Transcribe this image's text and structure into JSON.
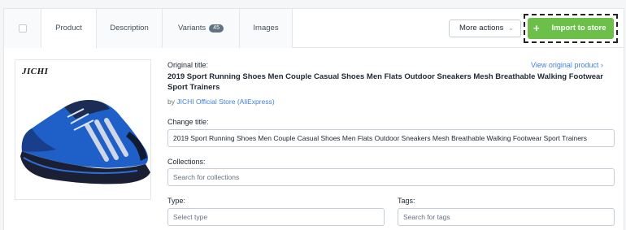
{
  "tabs": {
    "product": "Product",
    "description": "Description",
    "variants": "Variants",
    "variants_count": "45",
    "images": "Images"
  },
  "actions": {
    "more_actions": "More actions",
    "import_to_store": "Import to store"
  },
  "product": {
    "brand_logo_text": "JICHI",
    "original_title_label": "Original title:",
    "original_title": "2019 Sport Running Shoes Men Couple Casual Shoes Men Flats Outdoor Sneakers Mesh Breathable Walking Footwear Sport Trainers",
    "view_original_link": "View original product",
    "by_prefix": "by",
    "store_name": "JICHI Official Store (AliExpress)"
  },
  "form": {
    "change_title_label": "Change title:",
    "change_title_value": "2019 Sport Running Shoes Men Couple Casual Shoes Men Flats Outdoor Sneakers Mesh Breathable Walking Footwear Sport Trainers",
    "collections_label": "Collections:",
    "collections_placeholder": "Search for collections",
    "type_label": "Type:",
    "type_placeholder": "Select type",
    "tags_label": "Tags:",
    "tags_placeholder": "Search for tags"
  },
  "colors": {
    "accent_green": "#6cc04a",
    "link_blue": "#3f7fd9",
    "shoe_blue": "#1f5fc8"
  }
}
